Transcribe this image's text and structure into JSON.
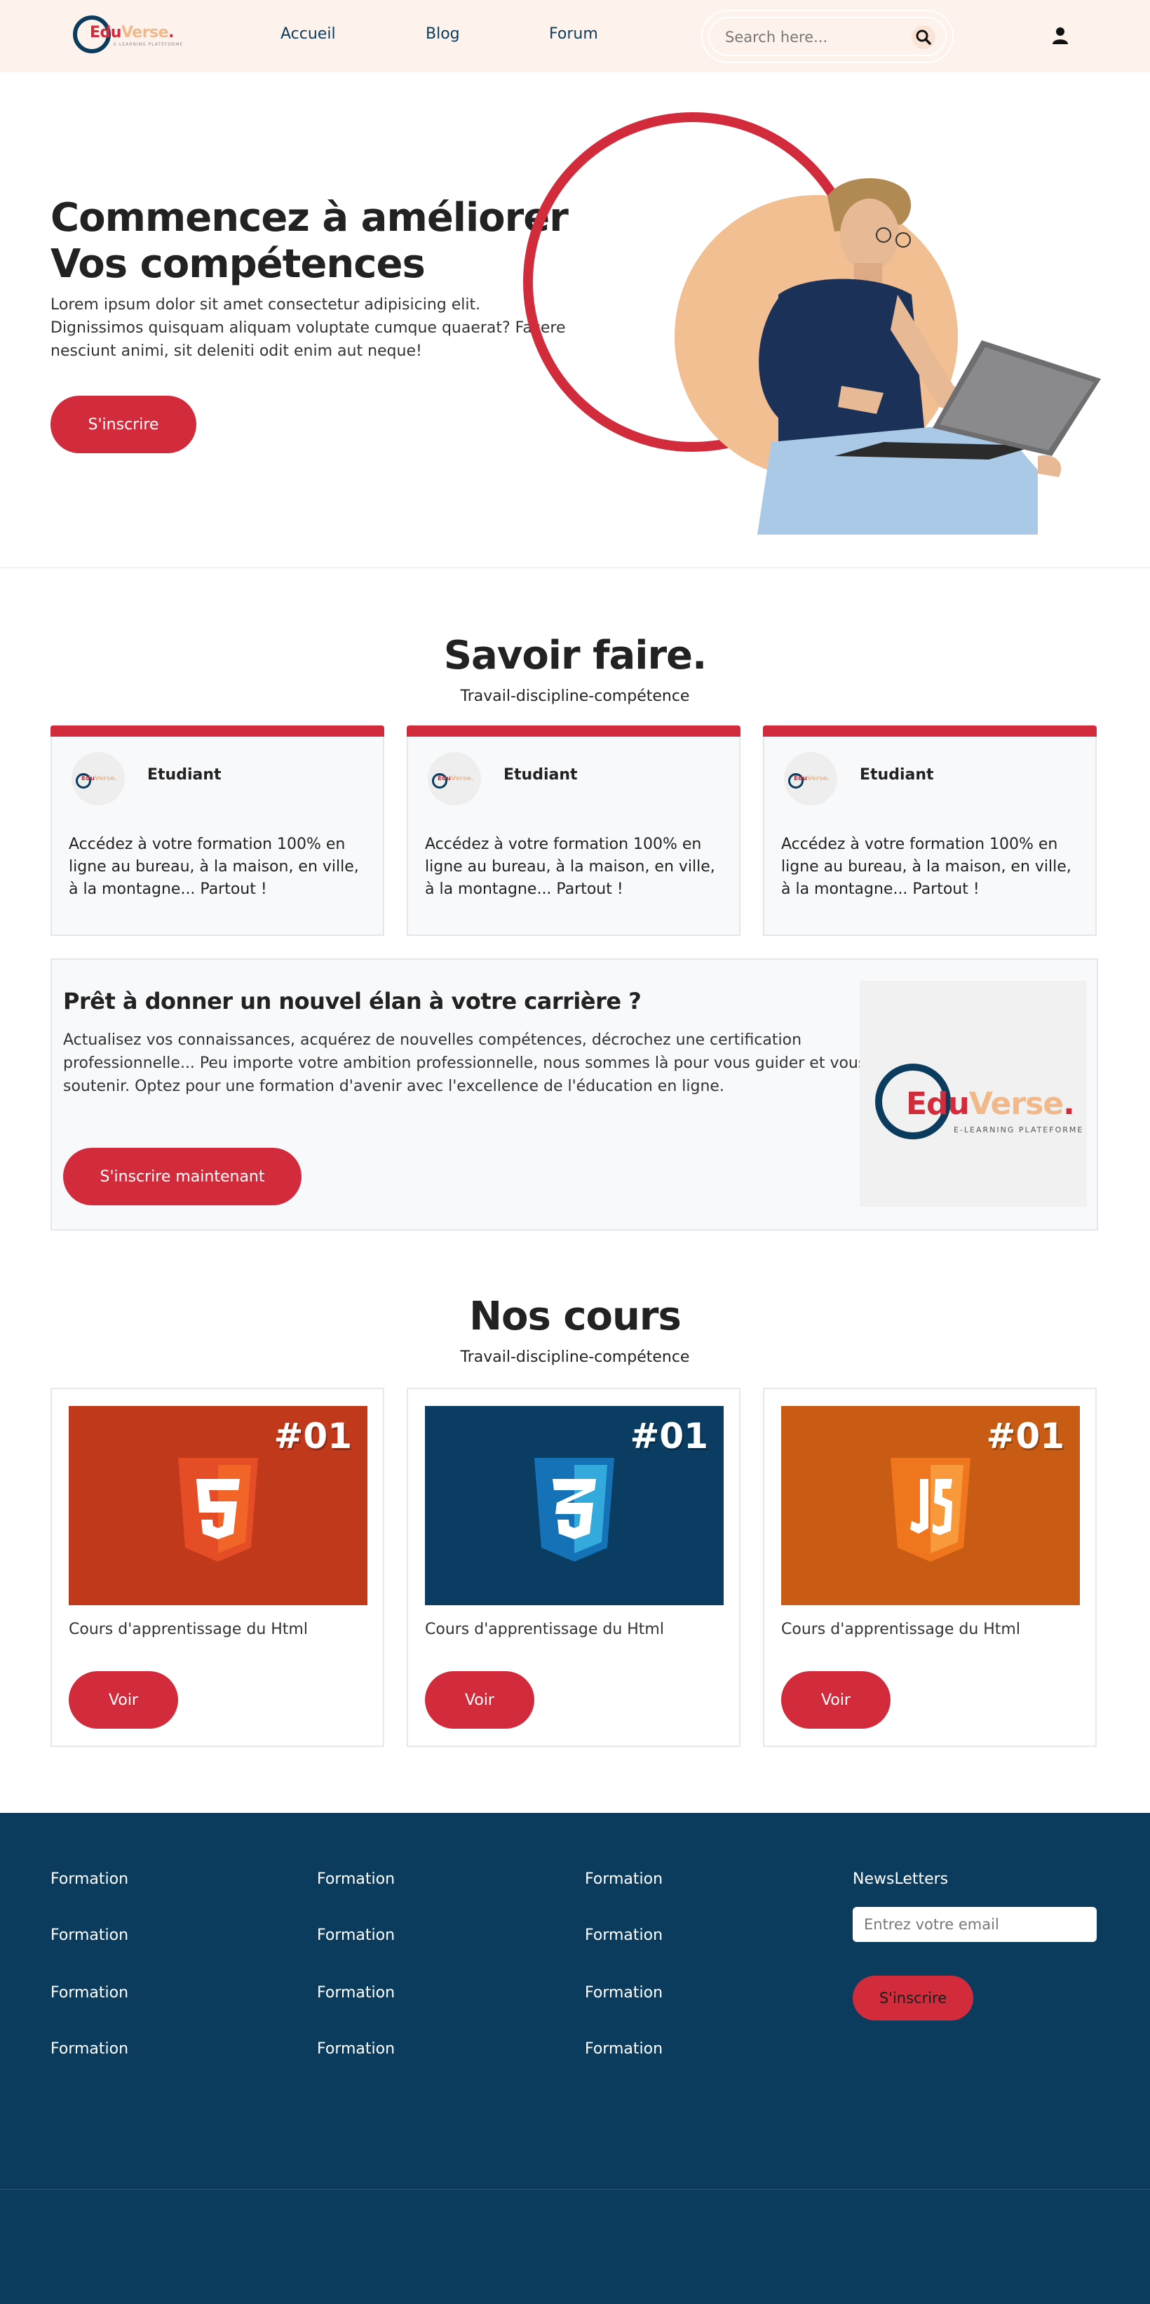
{
  "header": {
    "logo": {
      "edu": "Edu",
      "verse": "Verse",
      "dot": ".",
      "tagline": "E-LEARNING PLATEFORME"
    },
    "nav": [
      "Accueil",
      "Blog",
      "Forum"
    ],
    "search": {
      "placeholder": "Search here..."
    },
    "icons": {
      "search": "search-icon",
      "user": "user-icon"
    }
  },
  "hero": {
    "title_line1": "Commencez à améliorer",
    "title_line2": "Vos compétences",
    "text": "Lorem ipsum dolor sit amet consectetur adipisicing elit. Dignissimos quisquam aliquam voluptate cumque quaerat? Facere nesciunt animi, sit deleniti odit enim aut neque!",
    "button": "S'inscrire"
  },
  "savoir": {
    "title": "Savoir faire.",
    "subtitle": "Travail-discipline-compétence",
    "cards": [
      {
        "name": "Etudiant",
        "text": "Accédez à votre formation 100% en ligne au bureau, à la maison, en ville, à la montagne... Partout !"
      },
      {
        "name": "Etudiant",
        "text": "Accédez à votre formation 100% en ligne au bureau, à la maison, en ville, à la montagne... Partout !"
      },
      {
        "name": "Etudiant",
        "text": "Accédez à votre formation 100% en ligne au bureau, à la maison, en ville, à la montagne... Partout !"
      }
    ]
  },
  "cta": {
    "title": "Prêt à donner un nouvel élan à votre carrière ?",
    "text": "Actualisez vos connaissances, acquérez de nouvelles compétences, décrochez une certification professionnelle... Peu importe votre ambition professionnelle, nous sommes là pour vous guider et vous soutenir. Optez pour une formation d'avenir avec l'excellence de l'éducation en ligne.",
    "button": "S'inscrire maintenant",
    "logo": {
      "edu": "Edu",
      "verse": "Verse",
      "dot": ".",
      "tagline": "E-LEARNING PLATEFORME"
    }
  },
  "courses": {
    "title": "Nos cours",
    "subtitle": "Travail-discipline-compétence",
    "items": [
      {
        "number": "#01",
        "icon": "html5-icon",
        "bg": "#c0391b",
        "shield": "#e44d26",
        "shield_light": "#f16529",
        "title": "Cours d'apprentissage du Html",
        "button": "Voir"
      },
      {
        "number": "#01",
        "icon": "css3-icon",
        "bg": "#0b3d63",
        "shield": "#1572b6",
        "shield_light": "#33a9dc",
        "title": "Cours d'apprentissage du Html",
        "button": "Voir"
      },
      {
        "number": "#01",
        "icon": "js-icon",
        "bg": "#c85c14",
        "shield": "#f0761e",
        "shield_light": "#f89a3c",
        "title": "Cours d'apprentissage du Html",
        "button": "Voir"
      }
    ]
  },
  "footer": {
    "columns": [
      [
        "Formation",
        "Formation",
        "Formation",
        "Formation"
      ],
      [
        "Formation",
        "Formation",
        "Formation",
        "Formation"
      ],
      [
        "Formation",
        "Formation",
        "Formation",
        "Formation"
      ]
    ],
    "newsletter": {
      "title": "NewsLetters",
      "placeholder": "Entrez votre email",
      "button": "S'inscrire"
    }
  },
  "colors": {
    "accent": "#d12b3c",
    "navy": "#0b3c5d",
    "peach": "#f2bf93",
    "header_bg": "#fdf3ec"
  }
}
